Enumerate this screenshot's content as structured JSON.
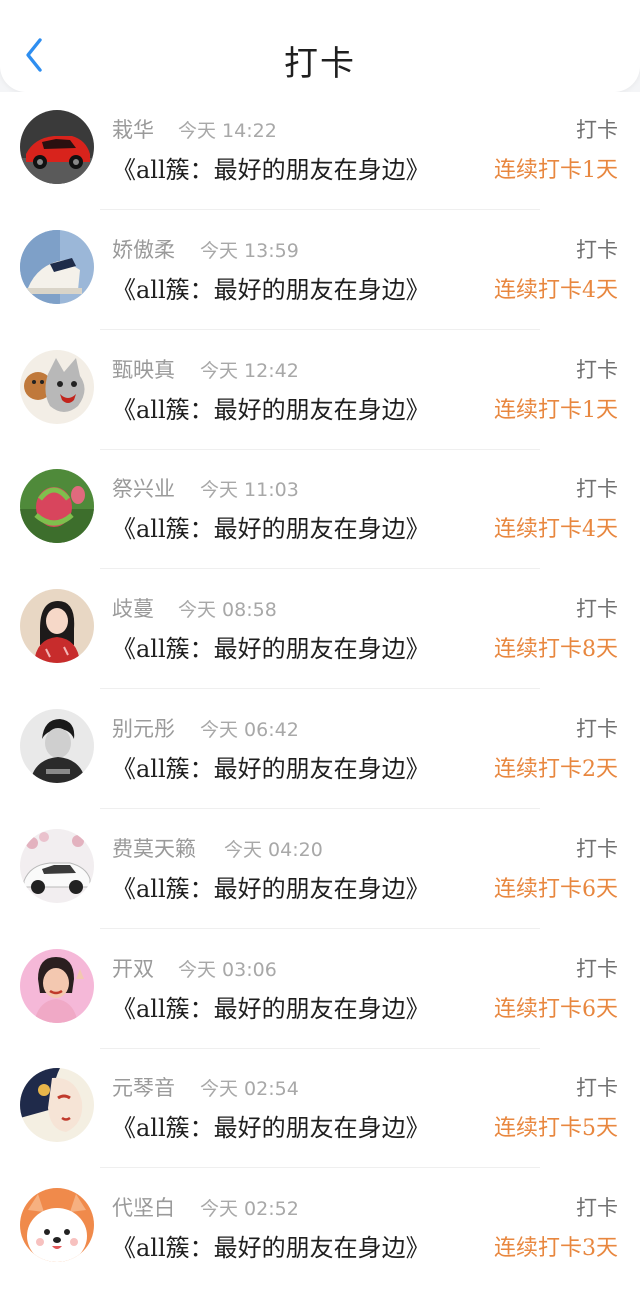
{
  "header": {
    "title": "打卡",
    "back_icon": "chevron-left-icon"
  },
  "checkins": [
    {
      "name": "栽华",
      "time": "今天 14:22",
      "action": "打卡",
      "book": "《all簇：最好的朋友在身边》",
      "streak": "连续打卡1天",
      "avatar": "red-car"
    },
    {
      "name": "娇傲柔",
      "time": "今天 13:59",
      "action": "打卡",
      "book": "《all簇：最好的朋友在身边》",
      "streak": "连续打卡4天",
      "avatar": "sneaker"
    },
    {
      "name": "甄映真",
      "time": "今天 12:42",
      "action": "打卡",
      "book": "《all簇：最好的朋友在身边》",
      "streak": "连续打卡1天",
      "avatar": "cartoon-wolf"
    },
    {
      "name": "祭兴业",
      "time": "今天 11:03",
      "action": "打卡",
      "book": "《all簇：最好的朋友在身边》",
      "streak": "连续打卡4天",
      "avatar": "flower-bud"
    },
    {
      "name": "歧蔓",
      "time": "今天 08:58",
      "action": "打卡",
      "book": "《all簇：最好的朋友在身边》",
      "streak": "连续打卡8天",
      "avatar": "girl-red-dress"
    },
    {
      "name": "别元彤",
      "time": "今天 06:42",
      "action": "打卡",
      "book": "《all簇：最好的朋友在身边》",
      "streak": "连续打卡2天",
      "avatar": "bw-portrait"
    },
    {
      "name": "费莫天籁",
      "time": "今天 04:20",
      "action": "打卡",
      "book": "《all簇：最好的朋友在身边》",
      "streak": "连续打卡6天",
      "avatar": "white-car"
    },
    {
      "name": "开双",
      "time": "今天 03:06",
      "action": "打卡",
      "book": "《all簇：最好的朋友在身边》",
      "streak": "连续打卡6天",
      "avatar": "cartoon-girl-pink"
    },
    {
      "name": "元琴音",
      "time": "今天 02:54",
      "action": "打卡",
      "book": "《all簇：最好的朋友在身边》",
      "streak": "连续打卡5天",
      "avatar": "illustrated-face"
    },
    {
      "name": "代坚白",
      "time": "今天 02:52",
      "action": "打卡",
      "book": "《all簇：最好的朋友在身边》",
      "streak": "连续打卡3天",
      "avatar": "cartoon-puppy"
    }
  ],
  "colors": {
    "accent_blue": "#2e8ef0",
    "streak_orange": "#e8873f",
    "name_gray": "#9a9a9a",
    "text_dark": "#1f1f1f"
  }
}
